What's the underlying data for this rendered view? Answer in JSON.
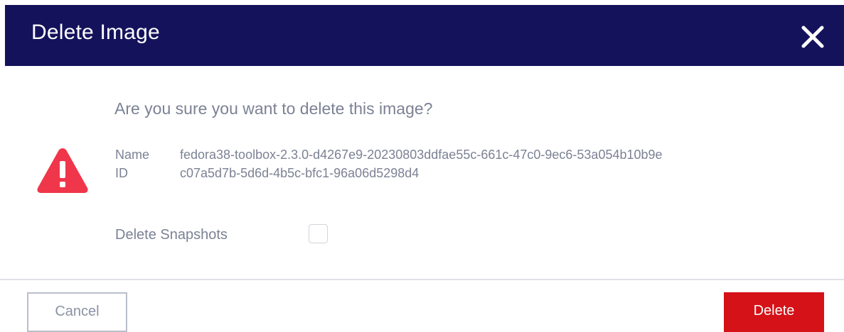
{
  "dialog": {
    "title": "Delete Image",
    "close_icon": "close-icon"
  },
  "body": {
    "question": "Are you sure you want to delete this image?",
    "warning_icon": "warning-triangle-icon",
    "name_label": "Name",
    "name_value": "fedora38-toolbox-2.3.0-d4267e9-20230803ddfae55c-661c-47c0-9ec6-53a054b10b9e",
    "id_label": "ID",
    "id_value": "c07a5d7b-5d6d-4b5c-bfc1-96a06d5298d4",
    "delete_snapshots_label": "Delete Snapshots",
    "delete_snapshots_checked": false
  },
  "footer": {
    "cancel_label": "Cancel",
    "delete_label": "Delete"
  },
  "colors": {
    "header_bg": "#15125c",
    "danger": "#d41218",
    "warning_icon": "#f0364a",
    "muted_text": "#7b8294"
  }
}
